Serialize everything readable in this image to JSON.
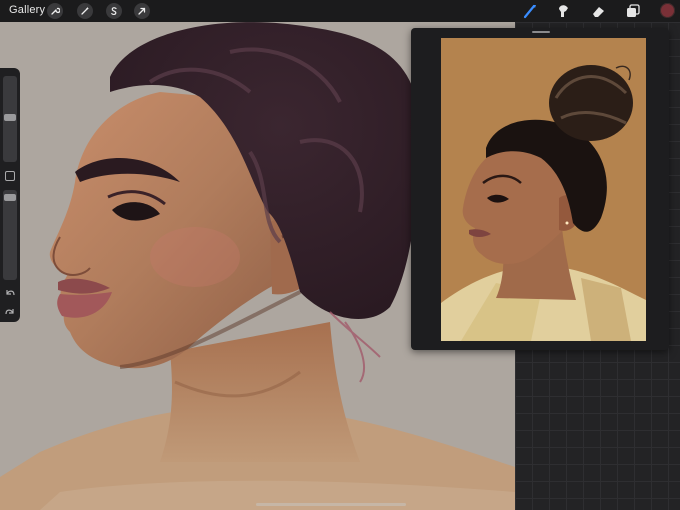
{
  "topbar": {
    "gallery_label": "Gallery",
    "left_tools": [
      {
        "name": "actions",
        "icon": "wrench-icon"
      },
      {
        "name": "adjustments",
        "icon": "magic-wand-icon"
      },
      {
        "name": "selection",
        "icon": "selection-s-icon"
      },
      {
        "name": "transform",
        "icon": "arrow-cursor-icon"
      }
    ],
    "right_tools": [
      {
        "name": "brush",
        "icon": "brush-icon",
        "active": true
      },
      {
        "name": "smudge",
        "icon": "smudge-icon"
      },
      {
        "name": "eraser",
        "icon": "eraser-icon"
      },
      {
        "name": "layers",
        "icon": "layers-icon"
      }
    ],
    "current_color": "#7a3037",
    "active_tool_color": "#3a8dff"
  },
  "sidebar": {
    "brush_size_level": 0.7,
    "opacity_level": 0.95,
    "modify_icon": "square-icon",
    "undo_icon": "undo-arrow-icon",
    "redo_icon": "redo-arrow-icon"
  },
  "reference": {
    "panel_title": "",
    "background_color": "#b4834e"
  },
  "canvas": {
    "background_color": "#ada69f"
  }
}
